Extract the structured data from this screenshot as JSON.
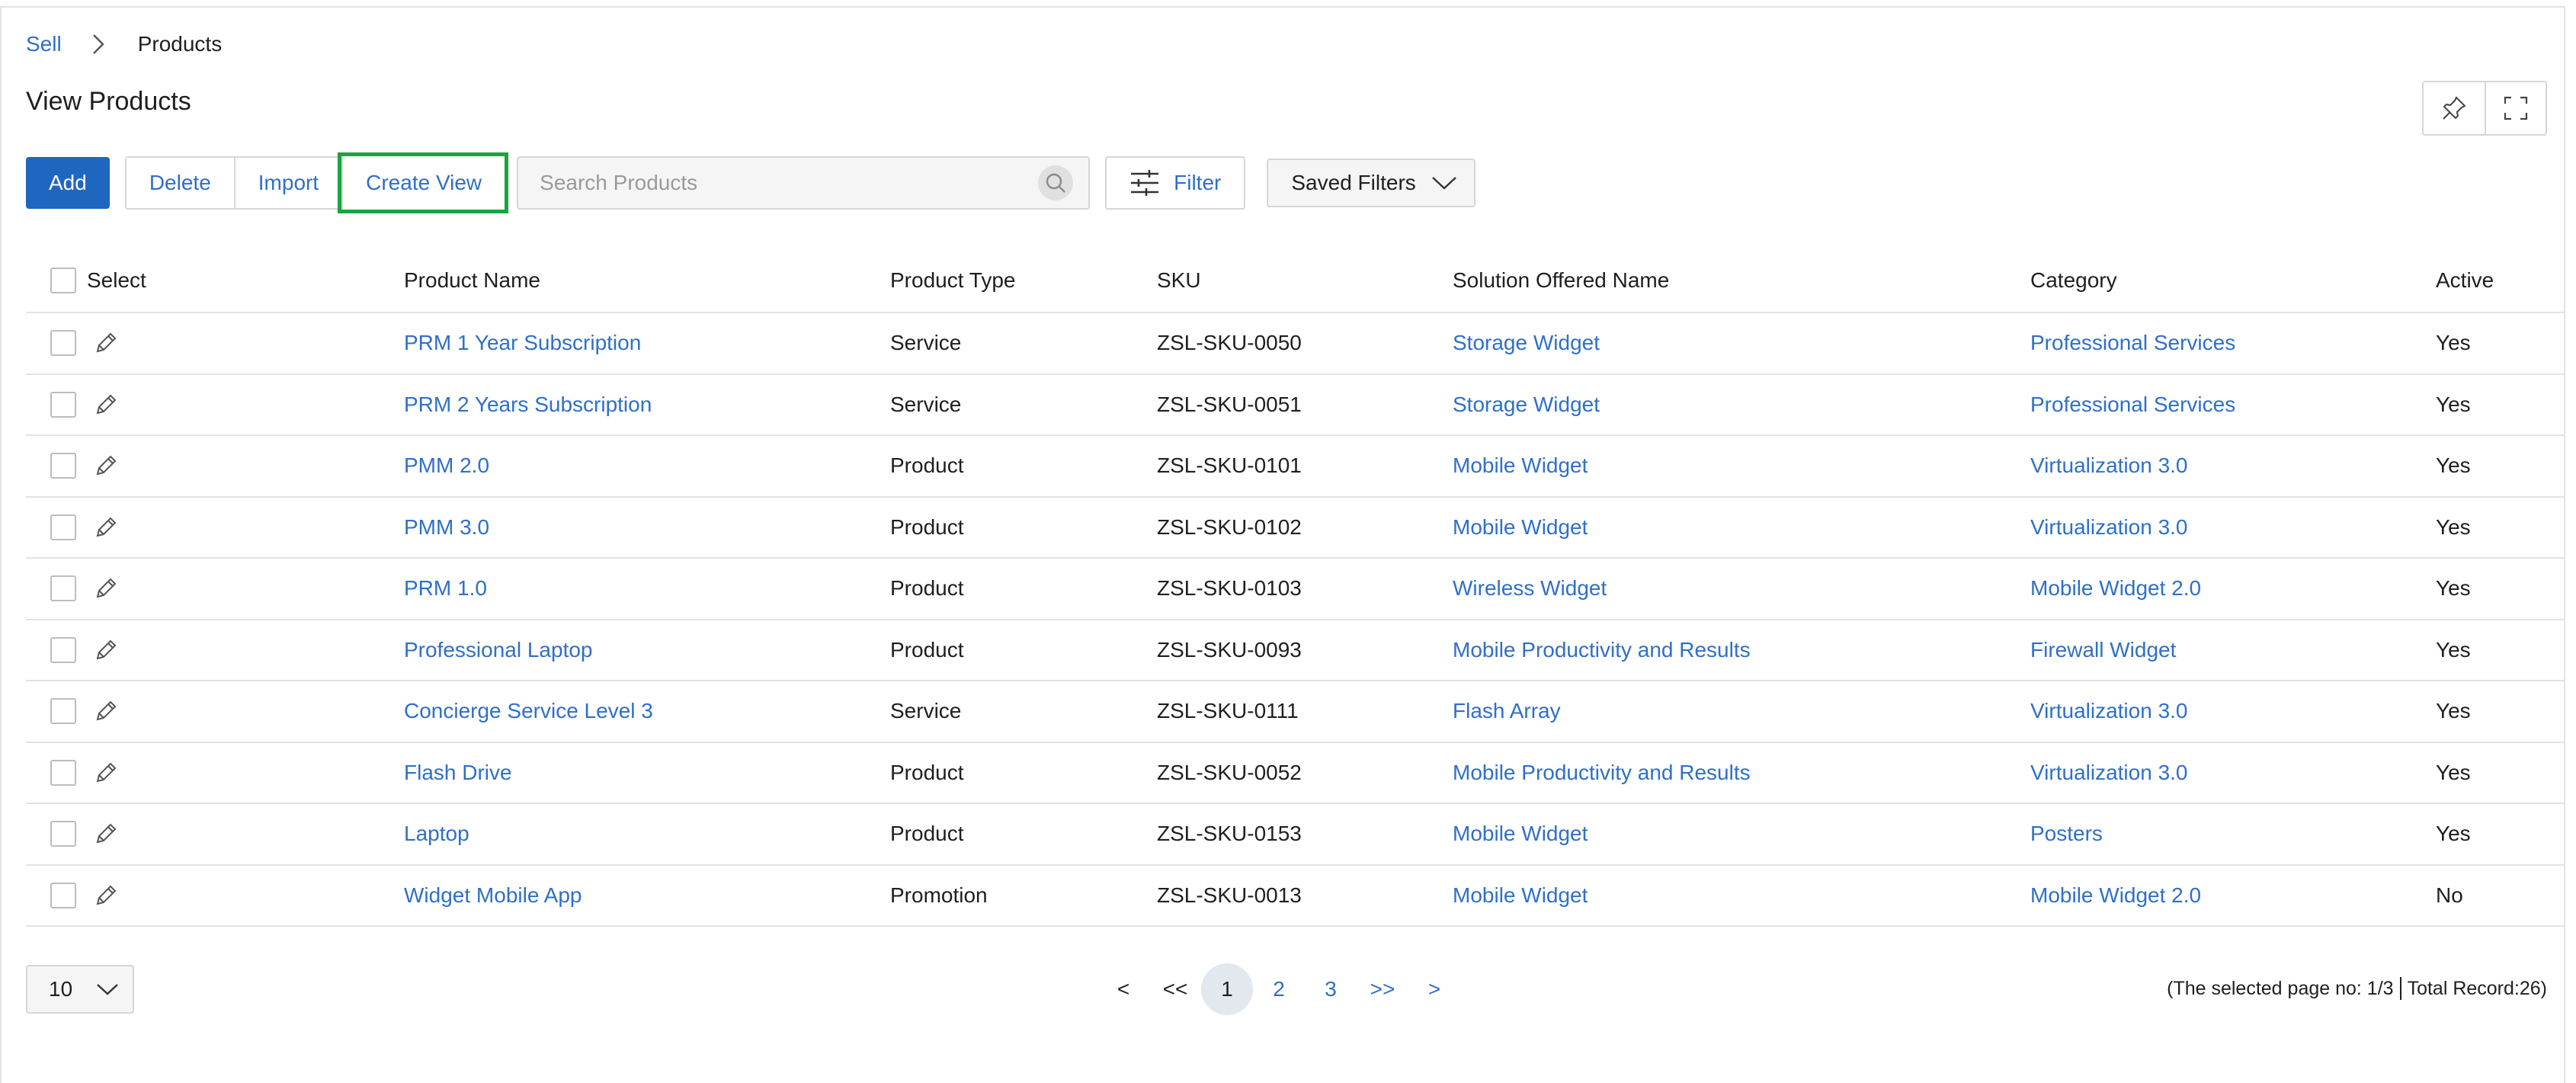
{
  "breadcrumb": {
    "parent": "Sell",
    "current": "Products"
  },
  "page_title": "View Products",
  "toolbar": {
    "add": "Add",
    "delete": "Delete",
    "import": "Import",
    "create_view": "Create View",
    "search_placeholder": "Search Products",
    "filter": "Filter",
    "saved_filters": "Saved Filters"
  },
  "table": {
    "headers": {
      "select": "Select",
      "name": "Product Name",
      "type": "Product Type",
      "sku": "SKU",
      "solution": "Solution Offered Name",
      "category": "Category",
      "active": "Active"
    },
    "rows": [
      {
        "name": "PRM 1 Year Subscription",
        "type": "Service",
        "sku": "ZSL-SKU-0050",
        "solution": "Storage Widget",
        "category": "Professional Services",
        "active": "Yes"
      },
      {
        "name": "PRM 2 Years Subscription",
        "type": "Service",
        "sku": "ZSL-SKU-0051",
        "solution": "Storage Widget",
        "category": "Professional Services",
        "active": "Yes"
      },
      {
        "name": "PMM 2.0",
        "type": "Product",
        "sku": "ZSL-SKU-0101",
        "solution": "Mobile Widget",
        "category": "Virtualization 3.0",
        "active": "Yes"
      },
      {
        "name": "PMM 3.0",
        "type": "Product",
        "sku": "ZSL-SKU-0102",
        "solution": "Mobile Widget",
        "category": "Virtualization 3.0",
        "active": "Yes"
      },
      {
        "name": "PRM 1.0",
        "type": "Product",
        "sku": "ZSL-SKU-0103",
        "solution": "Wireless Widget",
        "category": "Mobile Widget 2.0",
        "active": "Yes"
      },
      {
        "name": "Professional Laptop",
        "type": "Product",
        "sku": "ZSL-SKU-0093",
        "solution": "Mobile Productivity and Results",
        "category": "Firewall Widget",
        "active": "Yes"
      },
      {
        "name": "Concierge Service Level 3",
        "type": "Service",
        "sku": "ZSL-SKU-0111",
        "solution": "Flash Array",
        "category": "Virtualization 3.0",
        "active": "Yes"
      },
      {
        "name": "Flash Drive",
        "type": "Product",
        "sku": "ZSL-SKU-0052",
        "solution": "Mobile Productivity and Results",
        "category": "Virtualization 3.0",
        "active": "Yes"
      },
      {
        "name": "Laptop",
        "type": "Product",
        "sku": "ZSL-SKU-0153",
        "solution": "Mobile Widget",
        "category": "Posters",
        "active": "Yes"
      },
      {
        "name": "Widget Mobile App",
        "type": "Promotion",
        "sku": "ZSL-SKU-0013",
        "solution": "Mobile Widget",
        "category": "Mobile Widget 2.0",
        "active": "No"
      }
    ]
  },
  "pagination": {
    "page_size": "10",
    "prev": "<",
    "first": "<<",
    "pages": [
      "1",
      "2",
      "3"
    ],
    "last": ">>",
    "next": ">",
    "info_left": "(The selected page no: 1/3",
    "info_right": "Total Record:26)"
  },
  "colors": {
    "accent": "#1f66c1",
    "link": "#2f6fc9",
    "highlight": "#1aa33f"
  },
  "icons": [
    "chevron-right-icon",
    "pin-icon",
    "fullscreen-icon",
    "search-icon",
    "filter-sliders-icon",
    "chevron-down-icon",
    "pencil-icon"
  ]
}
